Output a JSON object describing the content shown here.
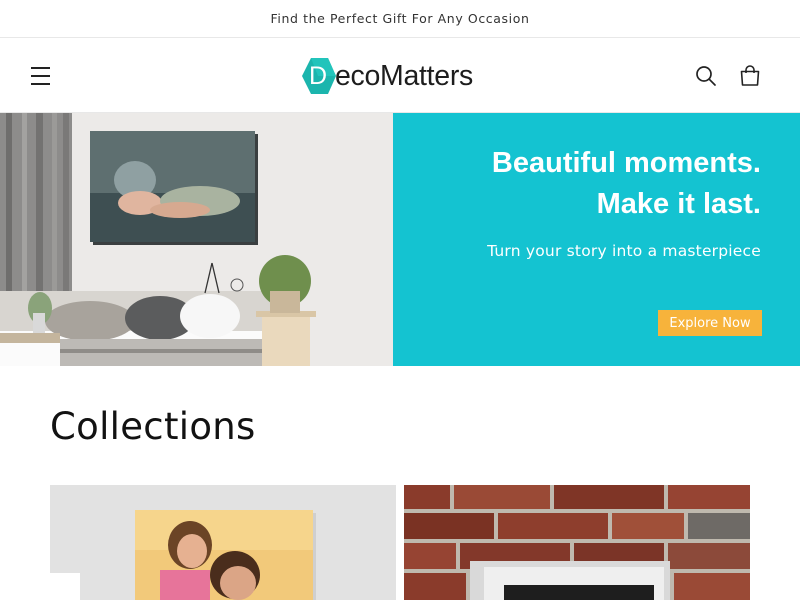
{
  "announcement": {
    "text": "Find the Perfect Gift For Any Occasion"
  },
  "header": {
    "brand_letter": "D",
    "brand_text": "ecoMatters",
    "brand_color": "#1bb5ad",
    "icons": [
      "menu-icon",
      "search-icon",
      "cart-icon"
    ]
  },
  "hero": {
    "heading_line1": "Beautiful moments.",
    "heading_line2": "Make it last.",
    "subheading": "Turn your story into a masterpiece",
    "cta_label": "Explore Now",
    "panel_color": "#14c3d1",
    "cta_color": "#f7b33b"
  },
  "collections": {
    "title": "Collections"
  }
}
